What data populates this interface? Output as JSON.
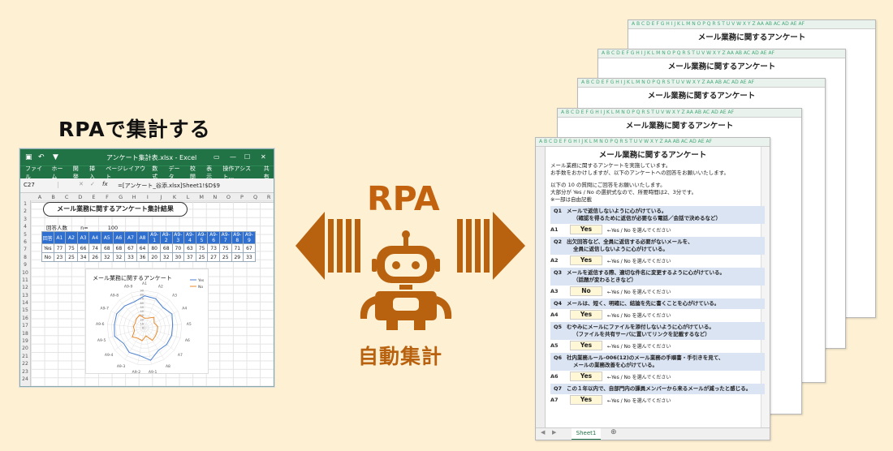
{
  "headline": "RPAで集計する",
  "center": {
    "rpa_label": "RPA",
    "subtitle": "自動集計"
  },
  "excel": {
    "window_title": "アンケート集計表.xlsx - Excel",
    "ribbon_tabs": [
      "ファイル",
      "ホーム",
      "開発",
      "挿入",
      "ページレイアウト",
      "数式",
      "データ",
      "校閲",
      "表示",
      "操作アシスト...",
      "共有"
    ],
    "name_box": "C27",
    "formula": "=[アンケート_谷添.xlsx]Sheet1!$D$9",
    "columns": [
      "A",
      "B",
      "C",
      "D",
      "E",
      "F",
      "G",
      "H",
      "I",
      "J",
      "K",
      "L",
      "M",
      "N",
      "O",
      "P",
      "Q",
      "R"
    ],
    "rows": [
      "1",
      "2",
      "3",
      "4",
      "5",
      "6",
      "7",
      "8",
      "9",
      "10",
      "11",
      "12",
      "13",
      "14",
      "15",
      "16",
      "17",
      "18",
      "19",
      "20",
      "21",
      "22",
      "23",
      "24"
    ],
    "sheet_title": "メール業務に関するアンケート集計結果",
    "respondents_label": "回答人数",
    "respondents_n": "n=",
    "respondents_value": "100",
    "table": {
      "header": [
        "回答",
        "A1",
        "A2",
        "A3",
        "A4",
        "A5",
        "A6",
        "A7",
        "A8",
        "A9-1",
        "A9-2",
        "A9-3",
        "A9-4",
        "A9-5",
        "A9-6",
        "A9-7",
        "A9-8",
        "A9-9"
      ],
      "rows": [
        [
          "Yes",
          "77",
          "75",
          "66",
          "74",
          "68",
          "68",
          "67",
          "64",
          "80",
          "68",
          "70",
          "63",
          "75",
          "73",
          "75",
          "71",
          "67"
        ],
        [
          "No",
          "23",
          "25",
          "34",
          "26",
          "32",
          "32",
          "33",
          "36",
          "20",
          "32",
          "30",
          "37",
          "25",
          "27",
          "25",
          "29",
          "33"
        ]
      ]
    }
  },
  "chart_data": {
    "type": "radar",
    "title": "メール業務に関するアンケート",
    "categories": [
      "A1",
      "A2",
      "A3",
      "A4",
      "A5",
      "A6",
      "A7",
      "A8",
      "A9-1",
      "A9-2",
      "A9-3",
      "A9-4",
      "A9-5",
      "A9-6",
      "A9-7",
      "A9-8",
      "A9-9"
    ],
    "series": [
      {
        "name": "Yes",
        "values": [
          77,
          75,
          66,
          74,
          68,
          68,
          67,
          64,
          80,
          68,
          70,
          63,
          75,
          73,
          75,
          71,
          67
        ],
        "color": "#4a7fd0"
      },
      {
        "name": "No",
        "values": [
          23,
          25,
          34,
          26,
          32,
          32,
          33,
          36,
          20,
          32,
          30,
          37,
          25,
          27,
          25,
          29,
          33
        ],
        "color": "#e8892b"
      }
    ],
    "ticks": [
      "0",
      "10",
      "20",
      "30",
      "40",
      "50",
      "60",
      "70",
      "80",
      "90"
    ],
    "rlim": [
      0,
      90
    ],
    "legend": "top-right"
  },
  "survey": {
    "title": "メール業務に関するアンケート",
    "column_letters": "A B C D E F G H I J K L M N O P Q R S T U V W X Y Z AA AB AC AD AE AF",
    "intro": [
      "メール業務に関するアンケートを実施しています。",
      "お手数をおかけしますが、以下のアンケートへの回答をお願いいたします。",
      "",
      "以下の 10 の質問にご回答をお願いいたします。",
      "大部分が Yes / No の選択式なので、所要時間は2、3分です。",
      "※一部は自由記載"
    ],
    "questions": [
      {
        "num": "Q1",
        "text": [
          "メールで返信しないように心がけている。",
          "（確認を得るために返信が必要なら電話／会話で決めるなど）"
        ],
        "ans": "A1",
        "value": "Yes"
      },
      {
        "num": "Q2",
        "text": [
          "出欠回答など、全員に返信する必要がないメールを、",
          "全員に返信しないように心がけている。"
        ],
        "ans": "A2",
        "value": "Yes"
      },
      {
        "num": "Q3",
        "text": [
          "メールを返信する際、適切な件名に変更するように心がけている。",
          "（話題が変わるときなど）"
        ],
        "ans": "A3",
        "value": "No"
      },
      {
        "num": "Q4",
        "text": [
          "メールは、短く、明確に、結論を先に書くことを心がけている。"
        ],
        "ans": "A4",
        "value": "Yes"
      },
      {
        "num": "Q5",
        "text": [
          "むやみにメールにファイルを添付しないように心がけている。",
          "（ファイルを共有サーバに置いてリンクを記載するなど）"
        ],
        "ans": "A5",
        "value": "Yes"
      },
      {
        "num": "Q6",
        "text": [
          "社内業務ルール-006(12)のメール業務の手順書・手引きを見て、",
          "メールの業務改善を心がけている。"
        ],
        "ans": "A6",
        "value": "Yes"
      },
      {
        "num": "Q7",
        "text": [
          "この１年以内で、自部門内の課員メンバーから来るメールが減ったと感じる。"
        ],
        "ans": "A7",
        "value": "Yes"
      }
    ],
    "answer_hint": "←Yes / No を選んでください",
    "sheet_tab": "Sheet1"
  }
}
